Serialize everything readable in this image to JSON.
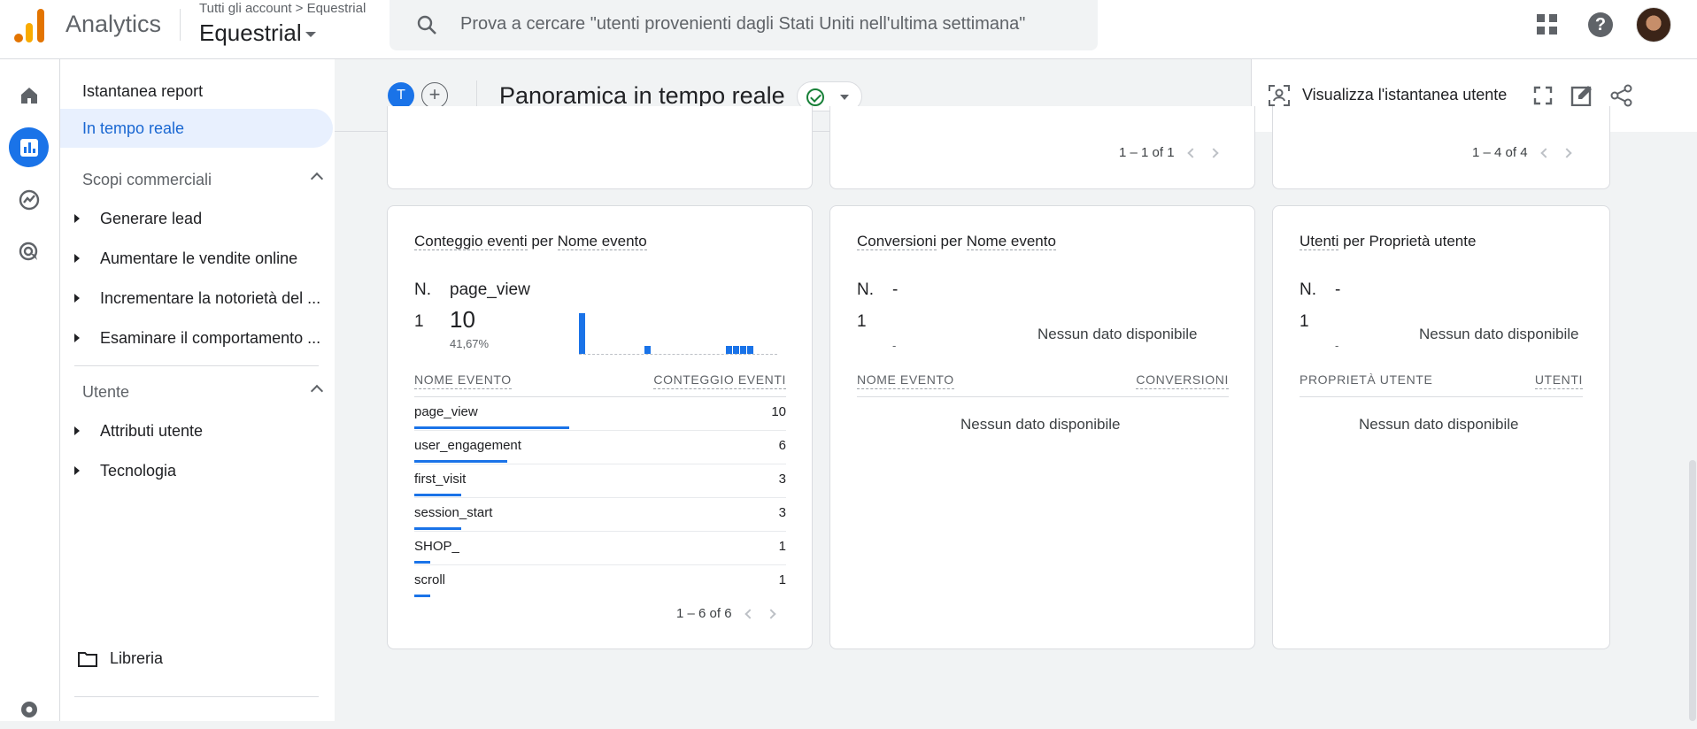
{
  "app": {
    "name": "Analytics",
    "breadcrumb": "Tutti gli account > Equestrial",
    "account": "Equestrial",
    "search_placeholder": "Prova a cercare \"utenti provenienti dagli Stati Uniti nell'ultima settimana\""
  },
  "rail": {
    "icons": [
      "home-icon",
      "reports-icon",
      "explore-icon",
      "advertising-icon",
      "settings-icon"
    ]
  },
  "sidenav": {
    "snapshot": "Istantanea report",
    "realtime": "In tempo reale",
    "section1": "Scopi commerciali",
    "section1_items": [
      "Generare lead",
      "Aumentare le vendite online",
      "Incrementare la notorietà del ...",
      "Esaminare il comportamento ..."
    ],
    "section2": "Utente",
    "section2_items": [
      "Attributi utente",
      "Tecnologia"
    ],
    "library": "Libreria"
  },
  "header": {
    "compare_chip": "T",
    "add_chip": "+",
    "title": "Panoramica in tempo reale",
    "snapshot_label": "Visualizza l'istantanea utente"
  },
  "top_cards": [
    {
      "pager": "1 – 1 of 1"
    },
    {
      "pager": "1 – 4 of 4"
    }
  ],
  "events_card": {
    "title_metric": "Conteggio eventi",
    "title_sep": " per ",
    "title_dim": "Nome evento",
    "n_label": "N.",
    "top_name": "page_view",
    "rank": "1",
    "top_value": "10",
    "top_pct": "41,67%",
    "col1": "NOME EVENTO",
    "col2": "CONTEGGIO EVENTI",
    "rows": [
      {
        "name": "page_view",
        "value": "10",
        "share": 1.0
      },
      {
        "name": "user_engagement",
        "value": "6",
        "share": 0.6
      },
      {
        "name": "first_visit",
        "value": "3",
        "share": 0.3
      },
      {
        "name": "session_start",
        "value": "3",
        "share": 0.3
      },
      {
        "name": "SHOP_",
        "value": "1",
        "share": 0.1
      },
      {
        "name": "scroll",
        "value": "1",
        "share": 0.1
      }
    ],
    "pager": "1 – 6 of 6"
  },
  "conversions_card": {
    "title_metric": "Conversioni",
    "title_sep": " per ",
    "title_dim": "Nome evento",
    "n_label": "N.",
    "top_name": "-",
    "rank": "1",
    "dash": "-",
    "nodata_chart": "Nessun dato disponibile",
    "col1": "NOME EVENTO",
    "col2": "CONVERSIONI",
    "nodata_table": "Nessun dato disponibile"
  },
  "users_card": {
    "title_metric": "Utenti",
    "title_sep": " per ",
    "title_dim": "Proprietà utente",
    "n_label": "N.",
    "top_name": "-",
    "rank": "1",
    "dash": "-",
    "nodata_chart": "Nessun dato disponibile",
    "col1": "PROPRIETÀ UTENTE",
    "col2": "UTENTI",
    "nodata_table": "Nessun dato disponibile"
  },
  "colors": {
    "accent": "#1a73e8",
    "active_bg": "#e8f0fe",
    "ok": "#188038"
  }
}
